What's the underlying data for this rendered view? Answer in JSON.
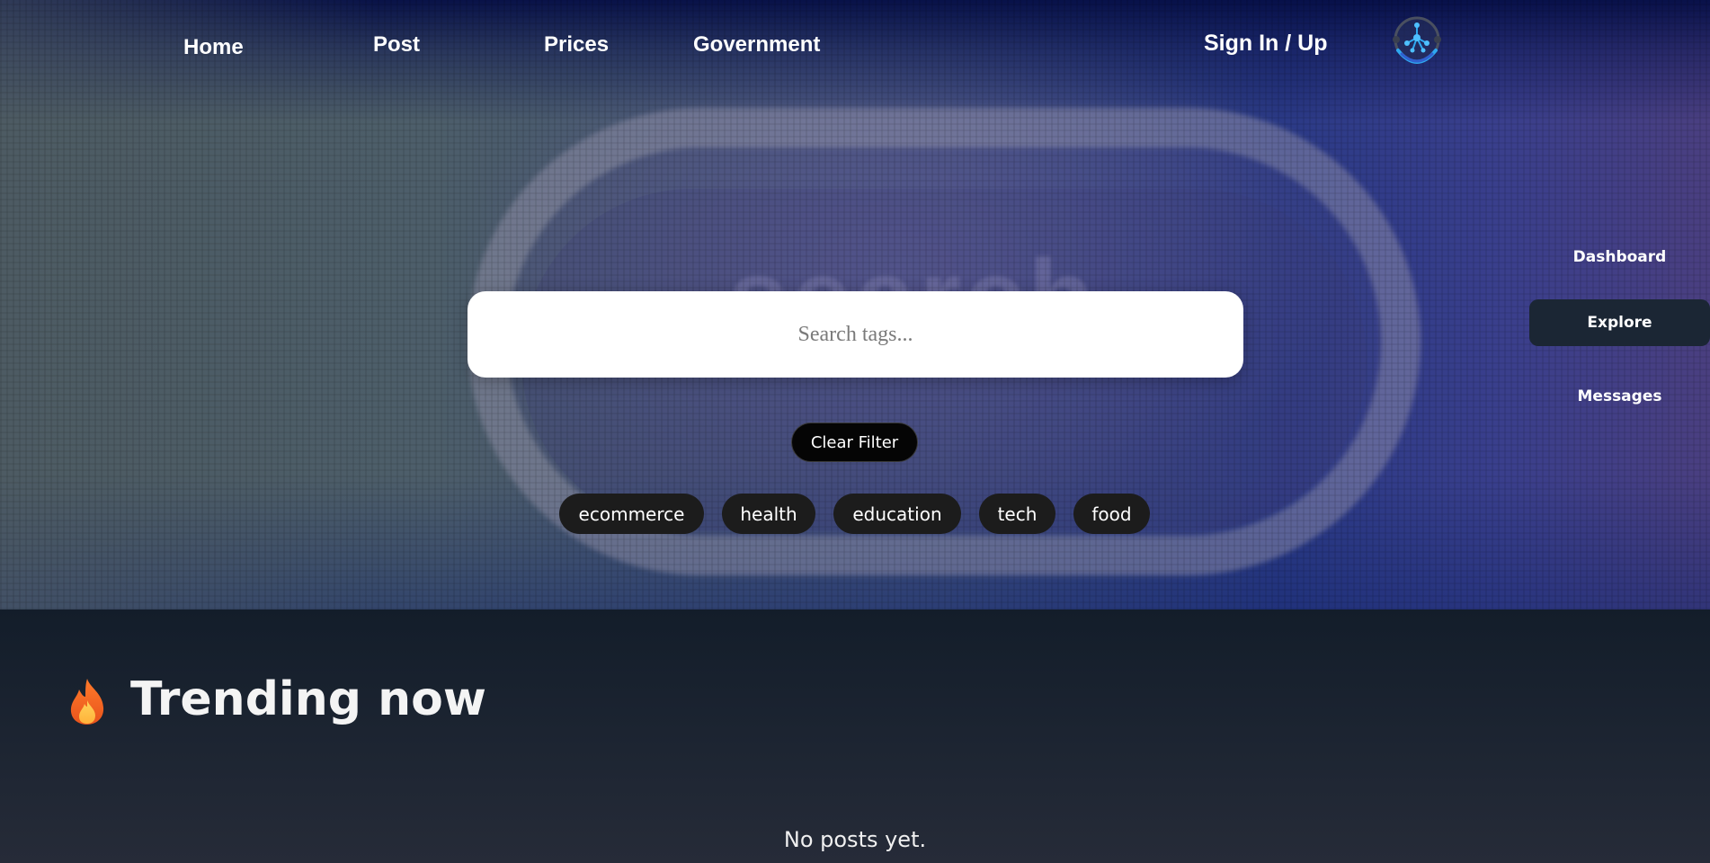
{
  "nav": {
    "home": "Home",
    "post": "Post",
    "prices": "Prices",
    "government": "Government",
    "sign_in": "Sign In / Up",
    "logo_icon": "network-shield-logo-icon"
  },
  "hero": {
    "background_word": "search"
  },
  "search": {
    "placeholder": "Search tags...",
    "value": ""
  },
  "clear_filter_label": "Clear Filter",
  "tags": [
    "ecommerce",
    "health",
    "education",
    "tech",
    "food"
  ],
  "sidebar": {
    "items": [
      {
        "label": "Dashboard",
        "active": false
      },
      {
        "label": "Explore",
        "active": true
      },
      {
        "label": "Messages",
        "active": false
      }
    ]
  },
  "trending": {
    "icon": "fire-icon",
    "title": "Trending now",
    "empty_message": "No posts yet."
  },
  "colors": {
    "page_bg": "#161f2c",
    "active_side_bg": "#1b2634",
    "tag_bg": "#1c1c1c",
    "button_bg": "#050505",
    "logo_accent": "#2fa8f0"
  }
}
